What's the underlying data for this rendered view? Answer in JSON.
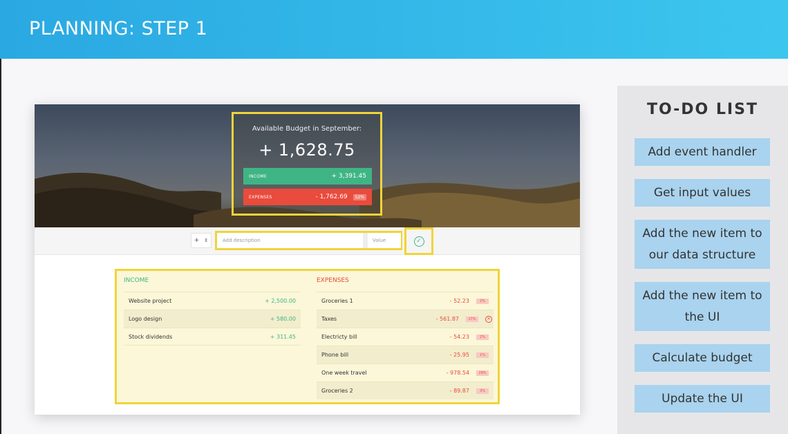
{
  "slide": {
    "title": "PLANNING: STEP 1"
  },
  "budget": {
    "title": "Available Budget in September:",
    "value": "+ 1,628.75",
    "income_label": "INCOME",
    "income_value": "+ 3,391.45",
    "expenses_label": "EXPENSES",
    "expenses_value": "- 1,762.69",
    "expenses_percent": "52%"
  },
  "input": {
    "type_value": "+",
    "description_placeholder": "Add description",
    "value_placeholder": "Value"
  },
  "income": {
    "title": "INCOME",
    "items": [
      {
        "description": "Website project",
        "value": "+ 2,500.00"
      },
      {
        "description": "Logo design",
        "value": "+ 580.00"
      },
      {
        "description": "Stock dividends",
        "value": "+ 311.45"
      }
    ]
  },
  "expenses": {
    "title": "EXPENSES",
    "items": [
      {
        "description": "Groceries 1",
        "value": "- 52.23",
        "percent": "2%"
      },
      {
        "description": "Taxes",
        "value": "- 561.87",
        "percent": "17%"
      },
      {
        "description": "Electricty bill",
        "value": "- 54.23",
        "percent": "2%"
      },
      {
        "description": "Phone bill",
        "value": "- 25.95",
        "percent": "1%"
      },
      {
        "description": "One week travel",
        "value": "- 978.54",
        "percent": "29%"
      },
      {
        "description": "Groceries 2",
        "value": "- 89.87",
        "percent": "3%"
      }
    ]
  },
  "todo": {
    "title": "TO-DO LIST",
    "items": [
      "Add event handler",
      "Get input values",
      "Add the new item to our data structure",
      "Add the new item to the UI",
      "Calculate budget",
      "Update the UI"
    ]
  },
  "colors": {
    "header": "#2aa8e2",
    "income": "#3fb585",
    "expense": "#e94b3c",
    "highlight": "#f0d43a",
    "todo_item": "#a9d3ee"
  }
}
